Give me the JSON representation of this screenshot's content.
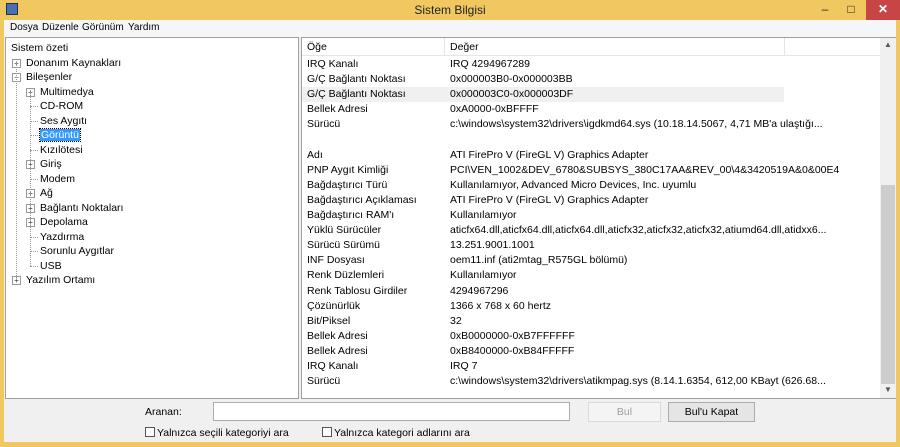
{
  "window": {
    "title": "Sistem Bilgisi",
    "minimize": "–",
    "maximize": "□",
    "close": "✕"
  },
  "menu": [
    "Dosya",
    "Düzenle",
    "Görünüm",
    "Yardım"
  ],
  "tree": [
    {
      "label": "Sistem özeti",
      "level": 0,
      "exp": ""
    },
    {
      "label": "Donanım Kaynakları",
      "level": 1,
      "exp": "+"
    },
    {
      "label": "Bileşenler",
      "level": 1,
      "exp": "-"
    },
    {
      "label": "Multimedya",
      "level": 2,
      "exp": "+"
    },
    {
      "label": "CD-ROM",
      "level": 2,
      "exp": ""
    },
    {
      "label": "Ses Aygıtı",
      "level": 2,
      "exp": ""
    },
    {
      "label": "Görüntü",
      "level": 2,
      "exp": "",
      "selected": true
    },
    {
      "label": "Kızılötesi",
      "level": 2,
      "exp": ""
    },
    {
      "label": "Giriş",
      "level": 2,
      "exp": "+"
    },
    {
      "label": "Modem",
      "level": 2,
      "exp": ""
    },
    {
      "label": "Ağ",
      "level": 2,
      "exp": "+"
    },
    {
      "label": "Bağlantı Noktaları",
      "level": 2,
      "exp": "+"
    },
    {
      "label": "Depolama",
      "level": 2,
      "exp": "+"
    },
    {
      "label": "Yazdırma",
      "level": 2,
      "exp": ""
    },
    {
      "label": "Sorunlu Aygıtlar",
      "level": 2,
      "exp": ""
    },
    {
      "label": "USB",
      "level": 2,
      "exp": ""
    },
    {
      "label": "Yazılım Ortamı",
      "level": 1,
      "exp": "+"
    }
  ],
  "table": {
    "headers": [
      "Öğe",
      "Değer"
    ],
    "rows": [
      [
        "IRQ Kanalı",
        "IRQ 4294967289"
      ],
      [
        "G/Ç Bağlantı Noktası",
        "0x000003B0-0x000003BB"
      ],
      [
        "G/Ç Bağlantı Noktası",
        "0x000003C0-0x000003DF"
      ],
      [
        "Bellek Adresi",
        "0xA0000-0xBFFFF"
      ],
      [
        "Sürücü",
        "c:\\windows\\system32\\drivers\\igdkmd64.sys (10.18.14.5067, 4,71 MB'a ulaştığı..."
      ],
      [
        "",
        ""
      ],
      [
        "Adı",
        "ATI FirePro V (FireGL V) Graphics Adapter"
      ],
      [
        "PNP Aygıt Kimliği",
        "PCI\\VEN_1002&DEV_6780&SUBSYS_380C17AA&REV_00\\4&3420519A&0&00E4"
      ],
      [
        "Bağdaştırıcı Türü",
        "Kullanılamıyor, Advanced Micro Devices, Inc. uyumlu"
      ],
      [
        "Bağdaştırıcı Açıklaması",
        "ATI FirePro V (FireGL V) Graphics Adapter"
      ],
      [
        "Bağdaştırıcı RAM'ı",
        "Kullanılamıyor"
      ],
      [
        "Yüklü Sürücüler",
        "aticfx64.dll,aticfx64.dll,aticfx64.dll,aticfx32,aticfx32,aticfx32,atiumd64.dll,atidxx6..."
      ],
      [
        "Sürücü Sürümü",
        "13.251.9001.1001"
      ],
      [
        "INF Dosyası",
        "oem11.inf (ati2mtag_R575GL bölümü)"
      ],
      [
        "Renk Düzlemleri",
        "Kullanılamıyor"
      ],
      [
        "Renk Tablosu Girdiler",
        "4294967296"
      ],
      [
        "Çözünürlük",
        "1366 x 768 x 60 hertz"
      ],
      [
        "Bit/Piksel",
        "32"
      ],
      [
        "Bellek Adresi",
        "0xB0000000-0xB7FFFFFF"
      ],
      [
        "Bellek Adresi",
        "0xB8400000-0xB84FFFFF"
      ],
      [
        "IRQ Kanalı",
        "IRQ 7"
      ],
      [
        "Sürücü",
        "c:\\windows\\system32\\drivers\\atikmpag.sys (8.14.1.6354, 612,00 KBayt (626.68..."
      ]
    ]
  },
  "search": {
    "label": "Aranan:",
    "value": "",
    "find": "Bul",
    "close_find": "Bul'u Kapat",
    "only_selected": "Yalnızca seçili kategoriyi ara",
    "only_names": "Yalnızca kategori adlarını ara"
  }
}
